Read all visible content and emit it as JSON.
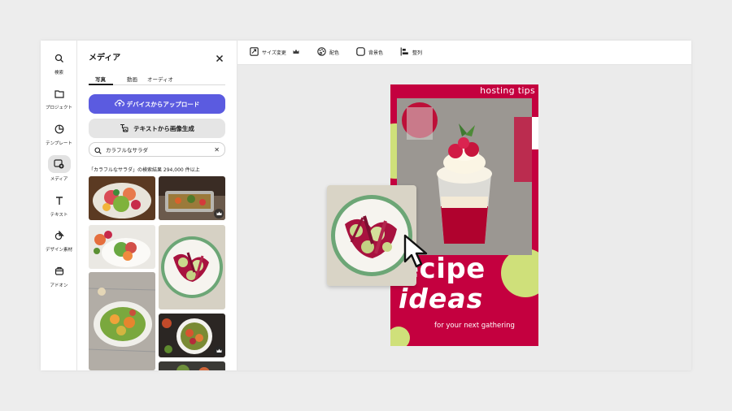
{
  "rail": {
    "items": [
      {
        "label": "検索",
        "icon": "search-icon"
      },
      {
        "label": "プロジェクト",
        "icon": "folder-icon"
      },
      {
        "label": "テンプレート",
        "icon": "template-icon"
      },
      {
        "label": "メディア",
        "icon": "media-icon"
      },
      {
        "label": "テキスト",
        "icon": "text-icon"
      },
      {
        "label": "デザイン素材",
        "icon": "elements-icon"
      },
      {
        "label": "アドオン",
        "icon": "addon-icon"
      }
    ],
    "active_index": 3
  },
  "panel": {
    "title": "メディア",
    "tabs": [
      {
        "label": "写真"
      },
      {
        "label": "動画"
      },
      {
        "label": "オーディオ"
      }
    ],
    "upload_button": "デバイスからアップロード",
    "generate_button": "テキストから画像生成",
    "search": {
      "value": "カラフルなサラダ",
      "placeholder": "カラフルなサラダ"
    },
    "result_count": "「カラフルなサラダ」の検索結果 294,000 件以上"
  },
  "toolbar": {
    "resize": "サイズ変更",
    "color": "配色",
    "background": "背景色",
    "align": "整列"
  },
  "design": {
    "tag": "hosting tips",
    "title_line1": "ecipe",
    "title_line2": "ideas",
    "subtitle": "for your next gathering"
  },
  "colors": {
    "accent": "#5b5be0",
    "design_red": "#c4003f",
    "lime": "#cfe07a"
  }
}
